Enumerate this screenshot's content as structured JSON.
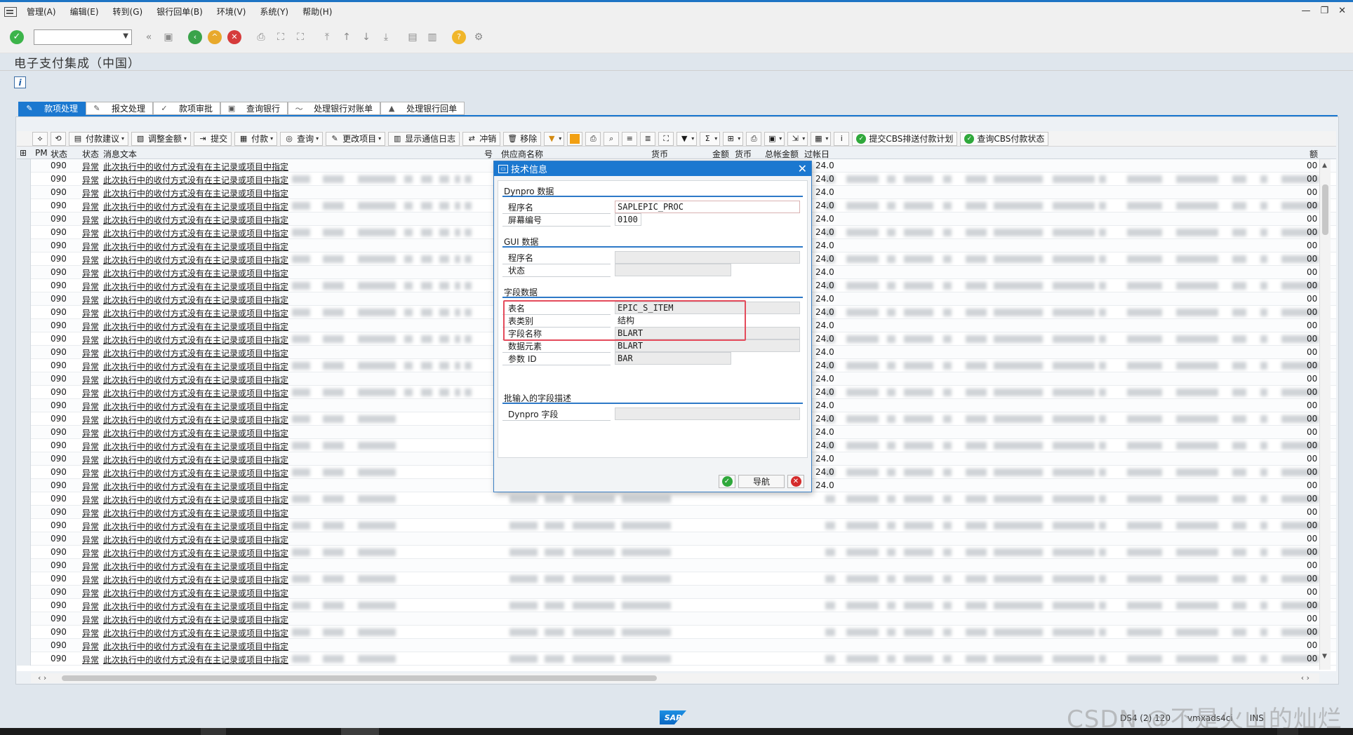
{
  "menubar": {
    "items": [
      "管理(A)",
      "编辑(E)",
      "转到(G)",
      "银行回单(B)",
      "环境(V)",
      "系统(Y)",
      "帮助(H)"
    ]
  },
  "window_controls": {
    "minimize": "—",
    "restore": "❐",
    "close": "✕"
  },
  "app": {
    "title": "电子支付集成（中国）"
  },
  "tabs": [
    {
      "label": "款项处理",
      "icon": "pencil-icon",
      "active": true
    },
    {
      "label": "报文处理",
      "icon": "edit-doc-icon"
    },
    {
      "label": "款项审批",
      "icon": "checkmark-icon"
    },
    {
      "label": "查询银行",
      "icon": "bank-icon"
    },
    {
      "label": "处理银行对账单",
      "icon": "chart-line-icon"
    },
    {
      "label": "处理银行回单",
      "icon": "stamp-icon"
    }
  ],
  "alv_toolbar": {
    "buttons": [
      {
        "label": "付款建议",
        "icon": "proposal-icon"
      },
      {
        "label": "调整金额",
        "icon": "adjust-icon"
      },
      {
        "label": "提交",
        "icon": "submit-icon"
      },
      {
        "label": "付款",
        "icon": "payment-icon"
      },
      {
        "label": "查询",
        "icon": "query-icon"
      },
      {
        "label": "更改项目",
        "icon": "change-icon"
      },
      {
        "label": "显示通信日志",
        "icon": "log-icon"
      },
      {
        "label": "冲销",
        "icon": "reverse-icon"
      },
      {
        "label": "移除",
        "icon": "trash-icon"
      }
    ],
    "cbs_buttons": [
      {
        "label": "提交CBS排送付款计划",
        "icon": "check-icon"
      },
      {
        "label": "查询CBS付款状态",
        "icon": "check-icon"
      }
    ]
  },
  "grid": {
    "columns": {
      "pm": "PM",
      "status1": "状态",
      "status2": "状态",
      "message": "消息文本",
      "vendor_name": "供应商名称",
      "currency": "货币",
      "amount": "金额",
      "currency2": "货币",
      "total_amount": "总帐金额",
      "posting_date": "过帐日",
      "hidden_no": "号",
      "last": "额"
    },
    "row_code": "090",
    "row_status": "异常",
    "row_message": "此次执行中的收付方式没有在主记录或项目中指定",
    "row_date_fragment": "24.0",
    "row_tail": "00",
    "row_count": 38
  },
  "dialog": {
    "title": "技术信息",
    "groups": {
      "dynpro": {
        "title": "Dynpro 数据",
        "program_label": "程序名",
        "program_value": "SAPLEPIC_PROC",
        "screen_label": "屏幕编号",
        "screen_value": "0100"
      },
      "gui": {
        "title": "GUI 数据",
        "program_label": "程序名",
        "program_value": "",
        "status_label": "状态",
        "status_value": ""
      },
      "field": {
        "title": "字段数据",
        "table_label": "表名",
        "table_value": "EPIC_S_ITEM",
        "table_type_label": "表类别",
        "table_type_value": "结构",
        "field_name_label": "字段名称",
        "field_name_value": "BLART",
        "data_element_label": "数据元素",
        "data_element_value": "BLART",
        "param_label": "参数 ID",
        "param_value": "BAR"
      },
      "batch": {
        "title": "批输入的字段描述",
        "dynpro_field_label": "Dynpro 字段",
        "dynpro_field_value": ""
      }
    },
    "buttons": {
      "ok": "✓",
      "navigate": "导航",
      "cancel": "✕"
    }
  },
  "statusbar": {
    "sap_logo": "SAP",
    "system": "DS4 (2) 120",
    "host": "vmxads4ci",
    "mode": "INS"
  },
  "watermark": "CSDN @不是火山的灿烂"
}
